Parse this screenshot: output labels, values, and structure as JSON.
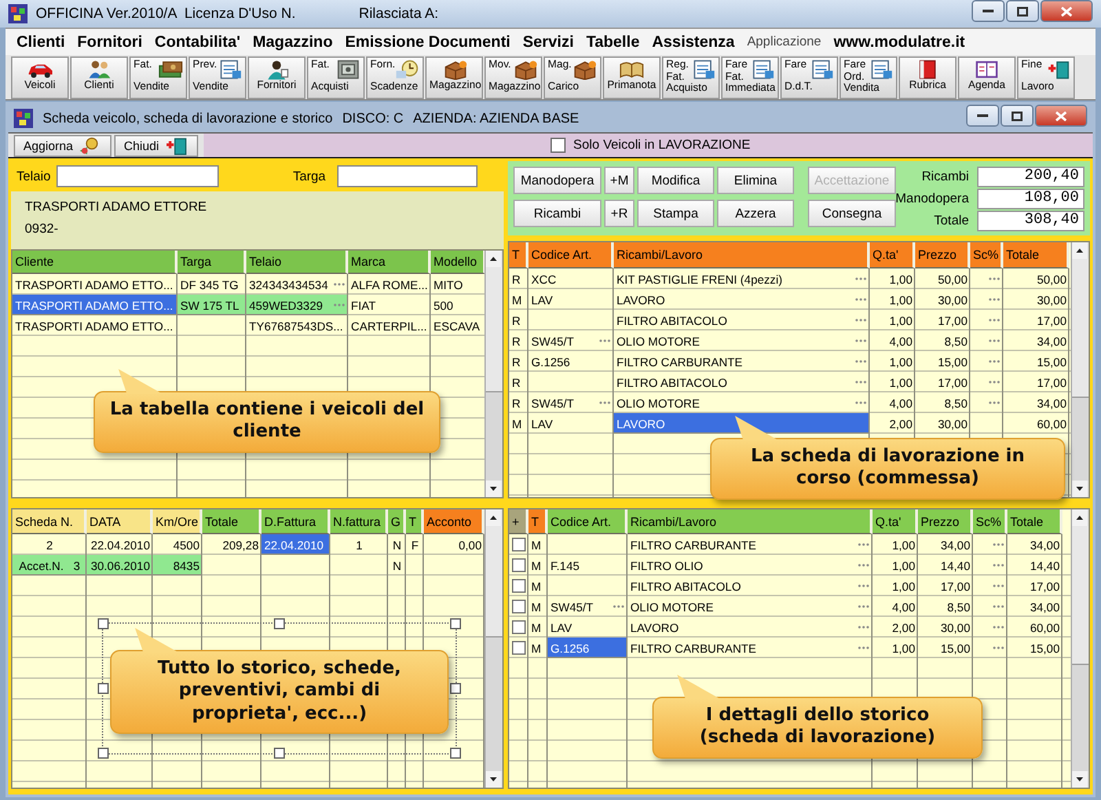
{
  "window": {
    "title": "OFFICINA Ver.2010/A  Licenza D'Uso N.",
    "licensed_to_label": "Rilasciata A:"
  },
  "menu": [
    {
      "label": "Clienti",
      "kind": "main"
    },
    {
      "label": "Fornitori",
      "kind": "main"
    },
    {
      "label": "Contabilita'",
      "kind": "main"
    },
    {
      "label": "Magazzino",
      "kind": "main"
    },
    {
      "label": "Emissione Documenti",
      "kind": "main"
    },
    {
      "label": "Servizi",
      "kind": "main"
    },
    {
      "label": "Tabelle",
      "kind": "main"
    },
    {
      "label": "Assistenza",
      "kind": "main"
    },
    {
      "label": "Applicazione",
      "kind": "small"
    },
    {
      "label": "www.modulatre.it",
      "kind": "link"
    }
  ],
  "toolbar": [
    {
      "lines": [
        "Veicoli"
      ]
    },
    {
      "lines": [
        "Clienti"
      ]
    },
    {
      "lines": [
        "Fat.",
        "Vendite"
      ]
    },
    {
      "lines": [
        "Prev.",
        "Vendite"
      ]
    },
    {
      "lines": [
        "Fornitori"
      ]
    },
    {
      "lines": [
        "Fat.",
        "Acquisti"
      ]
    },
    {
      "lines": [
        "Forn.",
        "Scadenze"
      ]
    },
    {
      "lines": [
        "Magazzino"
      ]
    },
    {
      "lines": [
        "Mov.",
        "Magazzino"
      ]
    },
    {
      "lines": [
        "Mag.",
        "Carico"
      ]
    },
    {
      "lines": [
        "Primanota"
      ]
    },
    {
      "lines": [
        "Reg.",
        "Fat.",
        "Acquisto"
      ]
    },
    {
      "lines": [
        "Fare",
        "Fat.",
        "Immediata"
      ]
    },
    {
      "lines": [
        "Fare",
        "D.d.T."
      ]
    },
    {
      "lines": [
        "Fare",
        "Ord.",
        "Vendita"
      ]
    },
    {
      "lines": [
        "Rubrica"
      ]
    },
    {
      "lines": [
        "Agenda"
      ]
    },
    {
      "lines": [
        "Fine",
        "Lavoro"
      ]
    }
  ],
  "form": {
    "title": "Scheda veicolo, scheda di lavorazione e storico",
    "disk": "DISCO: C",
    "company": "AZIENDA: AZIENDA BASE",
    "actions": [
      {
        "label": "Aggiorna"
      },
      {
        "label": "Chiudi"
      }
    ],
    "filter": {
      "label": "Solo Veicoli in LAVORAZIONE",
      "checked": false
    }
  },
  "search_fields": [
    {
      "label": "Telaio"
    },
    {
      "label": "Targa"
    }
  ],
  "customer": {
    "name": "TRASPORTI ADAMO ETTORE",
    "code": "0932-"
  },
  "vehicles": {
    "columns": [
      {
        "label": "Cliente"
      },
      {
        "label": "Targa"
      },
      {
        "label": "Telaio"
      },
      {
        "label": "Marca"
      },
      {
        "label": "Modello"
      }
    ],
    "rows": [
      {
        "selected": false,
        "cliente": "TRASPORTI ADAMO ETTO...",
        "targa": "DF 345 TG",
        "telaio": "324343434534",
        "telaio_lookup": true,
        "marca": "ALFA ROME...",
        "modello": "MITO"
      },
      {
        "selected": true,
        "cliente": "TRASPORTI ADAMO ETTO...",
        "targa": "SW 175 TL",
        "telaio": "459WED3329",
        "telaio_lookup": true,
        "marca": "FIAT",
        "modello": "500"
      },
      {
        "selected": false,
        "cliente": "TRASPORTI ADAMO ETTO...",
        "telaio": "TY67687543DS...",
        "telaio_lookup": false,
        "marca": "CARTERPIL...",
        "modello": "ESCAVA"
      }
    ]
  },
  "work_buttons": [
    {
      "label": "Manodopera",
      "disabled": false
    },
    {
      "label": "+M",
      "disabled": false
    },
    {
      "label": "Modifica",
      "disabled": false
    },
    {
      "label": "Elimina",
      "disabled": false
    },
    {
      "label": "Accettazione",
      "disabled": true
    },
    {
      "label": "Ricambi",
      "disabled": false
    },
    {
      "label": "+R",
      "disabled": false
    },
    {
      "label": "Stampa",
      "disabled": false
    },
    {
      "label": "Azzera",
      "disabled": false
    },
    {
      "label": "Consegna",
      "disabled": false
    }
  ],
  "totals": [
    {
      "label": "Ricambi",
      "value": "200,40"
    },
    {
      "label": "Manodopera",
      "value": "108,00"
    },
    {
      "label": "Totale",
      "value": "308,40"
    }
  ],
  "work_items": {
    "columns": [
      {
        "label": "T"
      },
      {
        "label": "Codice Art."
      },
      {
        "label": "Ricambi/Lavoro"
      },
      {
        "label": "Q.ta'"
      },
      {
        "label": "Prezzo"
      },
      {
        "label": "Sc%"
      },
      {
        "label": "Totale"
      }
    ],
    "rows": [
      {
        "selected": false,
        "type": "R",
        "code": "XCC",
        "code_lookup": false,
        "item": "KIT PASTIGLIE FRENI (4pezzi)",
        "item_lookup": true,
        "qty": "1,00",
        "price": "50,00",
        "discount_lookup": true,
        "total": "50,00"
      },
      {
        "selected": false,
        "type": "M",
        "code": "LAV",
        "code_lookup": false,
        "item": "LAVORO",
        "item_lookup": true,
        "qty": "1,00",
        "price": "30,00",
        "discount_lookup": true,
        "total": "30,00"
      },
      {
        "selected": false,
        "type": "R",
        "code_lookup": false,
        "item": "FILTRO ABITACOLO",
        "item_lookup": true,
        "qty": "1,00",
        "price": "17,00",
        "discount_lookup": true,
        "total": "17,00"
      },
      {
        "selected": false,
        "type": "R",
        "code": "SW45/T",
        "code_lookup": true,
        "item": "OLIO MOTORE",
        "item_lookup": true,
        "qty": "4,00",
        "price": "8,50",
        "discount_lookup": true,
        "total": "34,00"
      },
      {
        "selected": false,
        "type": "R",
        "code": "G.1256",
        "code_lookup": false,
        "item": "FILTRO CARBURANTE",
        "item_lookup": true,
        "qty": "1,00",
        "price": "15,00",
        "discount_lookup": true,
        "total": "15,00"
      },
      {
        "selected": false,
        "type": "R",
        "code_lookup": false,
        "item": "FILTRO ABITACOLO",
        "item_lookup": true,
        "qty": "1,00",
        "price": "17,00",
        "discount_lookup": true,
        "total": "17,00"
      },
      {
        "selected": false,
        "type": "R",
        "code": "SW45/T",
        "code_lookup": true,
        "item": "OLIO MOTORE",
        "item_lookup": true,
        "qty": "4,00",
        "price": "8,50",
        "discount_lookup": true,
        "total": "34,00"
      },
      {
        "selected": true,
        "type": "M",
        "code": "LAV",
        "code_lookup": false,
        "item": "LAVORO",
        "item_lookup": false,
        "qty": "2,00",
        "price": "30,00",
        "discount_lookup": false,
        "total": "60,00"
      }
    ]
  },
  "history": {
    "columns": [
      {
        "label": "Scheda N.",
        "color": "#f8e488"
      },
      {
        "label": "DATA",
        "color": "#f8e488"
      },
      {
        "label": "Km/Ore",
        "color": "#f8e488"
      },
      {
        "label": "Totale",
        "color": "#84cc50"
      },
      {
        "label": "D.Fattura",
        "color": "#84cc50"
      },
      {
        "label": "N.fattura",
        "color": "#84cc50"
      },
      {
        "label": "G",
        "color": "#84cc50"
      },
      {
        "label": "T",
        "color": "#84cc50"
      },
      {
        "label": "Acconto",
        "color": "#f6801e"
      }
    ],
    "rows": [
      {
        "kind": "scheda",
        "selected": true,
        "scheda": "2",
        "data": "22.04.2010",
        "km": "4500",
        "totale": "209,28",
        "d_fattura": "22.04.2010",
        "n_fattura": "1",
        "g": "N",
        "t": "F",
        "acconto": "0,00"
      },
      {
        "kind": "accettazione",
        "selected": false,
        "scheda": "Accet.N.   3",
        "data": "30.06.2010",
        "km": "8435",
        "g": "N"
      }
    ]
  },
  "history_details": {
    "columns": [
      {
        "label": "+",
        "color": "#a8a47c"
      },
      {
        "label": "T",
        "color": "#f6801e"
      },
      {
        "label": "Codice Art.",
        "color": "#84cc50"
      },
      {
        "label": "Ricambi/Lavoro",
        "color": "#84cc50"
      },
      {
        "label": "Q.ta'",
        "color": "#84cc50"
      },
      {
        "label": "Prezzo",
        "color": "#84cc50"
      },
      {
        "label": "Sc%",
        "color": "#84cc50"
      },
      {
        "label": "Totale",
        "color": "#84cc50"
      }
    ],
    "rows": [
      {
        "checked": false,
        "selected": false,
        "type": "M",
        "code_lookup": false,
        "item": "FILTRO CARBURANTE",
        "item_lookup": true,
        "qty": "1,00",
        "price": "34,00",
        "discount_lookup": true,
        "total": "34,00"
      },
      {
        "checked": false,
        "selected": false,
        "type": "M",
        "code": "F.145",
        "code_lookup": false,
        "item": "FILTRO OLIO",
        "item_lookup": true,
        "qty": "1,00",
        "price": "14,40",
        "discount_lookup": true,
        "total": "14,40"
      },
      {
        "checked": false,
        "selected": false,
        "type": "M",
        "code_lookup": false,
        "item": "FILTRO ABITACOLO",
        "item_lookup": true,
        "qty": "1,00",
        "price": "17,00",
        "discount_lookup": true,
        "total": "17,00"
      },
      {
        "checked": false,
        "selected": false,
        "type": "M",
        "code": "SW45/T",
        "code_lookup": true,
        "item": "OLIO MOTORE",
        "item_lookup": true,
        "qty": "4,00",
        "price": "8,50",
        "discount_lookup": true,
        "total": "34,00"
      },
      {
        "checked": false,
        "selected": false,
        "type": "M",
        "code": "LAV",
        "code_lookup": false,
        "item": "LAVORO",
        "item_lookup": true,
        "qty": "2,00",
        "price": "30,00",
        "discount_lookup": true,
        "total": "60,00"
      },
      {
        "checked": false,
        "selected": true,
        "type": "M",
        "code": "G.1256",
        "code_lookup": false,
        "item": "FILTRO CARBURANTE",
        "item_lookup": true,
        "qty": "1,00",
        "price": "15,00",
        "discount_lookup": true,
        "total": "15,00"
      }
    ]
  },
  "callouts": [
    {
      "text": "La tabella contiene i veicoli del cliente",
      "selected": false
    },
    {
      "text": "La scheda di lavorazione in corso (commessa)",
      "selected": false
    },
    {
      "text": "Tutto lo storico, schede, preventivi, cambi di proprieta', ecc...)",
      "selected": true
    },
    {
      "text": "I dettagli dello storico (scheda di lavorazione)",
      "selected": false
    }
  ]
}
